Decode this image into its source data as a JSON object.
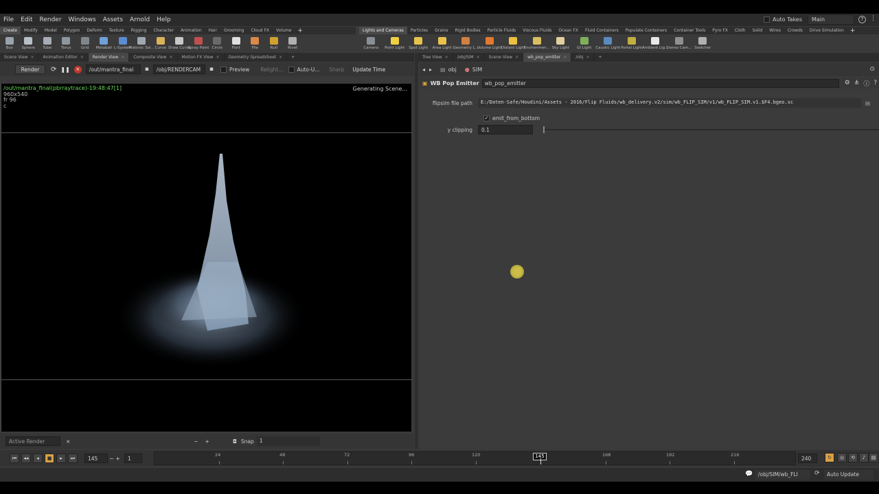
{
  "menubar": {
    "items": [
      "File",
      "Edit",
      "Render",
      "Windows",
      "Assets",
      "Arnold",
      "Help"
    ],
    "autotakes_label": "Auto Takes",
    "desktop": "Main"
  },
  "left_shelf": {
    "tabs": [
      "Create",
      "Modify",
      "Model",
      "Polygon",
      "Deform",
      "Texture",
      "Rigging",
      "Character",
      "Animation",
      "Hair",
      "Grooming",
      "Cloud FX",
      "Volume"
    ],
    "active_tab": 0,
    "tools": [
      {
        "label": "Box",
        "icon": "box-icon",
        "color": "#9aa3ad"
      },
      {
        "label": "Sphere",
        "icon": "sphere-icon",
        "color": "#b8bfc6"
      },
      {
        "label": "Tube",
        "icon": "tube-icon",
        "color": "#a6adb4"
      },
      {
        "label": "Torus",
        "icon": "torus-icon",
        "color": "#8f969c"
      },
      {
        "label": "Grid",
        "icon": "grid-icon",
        "color": "#7f868c"
      },
      {
        "label": "Metaball",
        "icon": "metaball-icon",
        "color": "#6fa0d8"
      },
      {
        "label": "L-System",
        "icon": "lsystem-icon",
        "color": "#5b8bd0"
      },
      {
        "label": "Platonic Sol...",
        "icon": "platonic-icon",
        "color": "#a1a8ae"
      },
      {
        "label": "Curve",
        "icon": "curve-icon",
        "color": "#d8b35a"
      },
      {
        "label": "Draw Curve",
        "icon": "draw-curve-icon",
        "color": "#c8c8c8"
      },
      {
        "label": "Spray Paint",
        "icon": "spray-paint-icon",
        "color": "#c0504d"
      },
      {
        "label": "Circle",
        "icon": "circle-icon",
        "color": "#6a6a6a"
      },
      {
        "label": "Font",
        "icon": "font-icon",
        "color": "#e0e0e0"
      },
      {
        "label": "File",
        "icon": "file-icon",
        "color": "#d9894a"
      },
      {
        "label": "Null",
        "icon": "null-icon",
        "color": "#d0a030"
      },
      {
        "label": "Rivet",
        "icon": "rivet-icon",
        "color": "#b0b0b0"
      }
    ]
  },
  "right_shelf": {
    "tabs": [
      "Lights and Cameras",
      "Particles",
      "Grains",
      "Rigid Bodies",
      "Particle Fluids",
      "Viscous Fluids",
      "Ocean FX",
      "Fluid Containers",
      "Populate Containers",
      "Container Tools",
      "Pyro FX",
      "Cloth",
      "Solid",
      "Wires",
      "Crowds",
      "Drive Simulation"
    ],
    "active_tab": 0,
    "tools": [
      {
        "label": "Camera",
        "icon": "camera-icon",
        "color": "#8a8f95"
      },
      {
        "label": "Point Light",
        "icon": "point-light-icon",
        "color": "#f0d040"
      },
      {
        "label": "Spot Light",
        "icon": "spot-light-icon",
        "color": "#e6c34a"
      },
      {
        "label": "Area Light",
        "icon": "area-light-icon",
        "color": "#e8c24c"
      },
      {
        "label": "Geometry L...",
        "icon": "geometry-light-icon",
        "color": "#d08040"
      },
      {
        "label": "Volume Light",
        "icon": "volume-light-icon",
        "color": "#e07a30"
      },
      {
        "label": "Distant Light",
        "icon": "distant-light-icon",
        "color": "#ecc040"
      },
      {
        "label": "Environmen...",
        "icon": "environment-light-icon",
        "color": "#d8c060"
      },
      {
        "label": "Sky Light",
        "icon": "sky-light-icon",
        "color": "#e0d0a0"
      },
      {
        "label": "GI Light",
        "icon": "gi-light-icon",
        "color": "#7fb05a"
      },
      {
        "label": "Caustic Light",
        "icon": "caustic-light-icon",
        "color": "#5a8ac0"
      },
      {
        "label": "Portal Light",
        "icon": "portal-light-icon",
        "color": "#c0b040"
      },
      {
        "label": "Ambient Lig...",
        "icon": "ambient-light-icon",
        "color": "#e8e8e8"
      },
      {
        "label": "Stereo Cam...",
        "icon": "stereo-camera-icon",
        "color": "#909090"
      },
      {
        "label": "Switcher",
        "icon": "switcher-icon",
        "color": "#b0b0b0"
      }
    ]
  },
  "left_pane_tabs": [
    "Scene View",
    "Animation Editor",
    "Render View",
    "Composite View",
    "Motion FX View",
    "Geometry Spreadsheet"
  ],
  "right_pane_tabs": [
    "Tree View",
    "/obj/SIM",
    "Scene View",
    "wb_pop_emitter",
    "/obj"
  ],
  "render_toolbar": {
    "render_label": "Render",
    "rop_path": "/out/mantra_final",
    "camera_path": "/obj/RENDERCAM",
    "preview_label": "Preview",
    "relight_label": "Relight...",
    "autoupdate_label": "Auto-U...",
    "sharp_label": "Sharp",
    "update_time_label": "Update Time"
  },
  "viewport": {
    "info_path": "/out/mantra_final(pbrraytrace)-19:48:47[1]",
    "resolution": "960x540",
    "frame_info": "fr 96",
    "extra": "c",
    "status": "Generating Scene..."
  },
  "viewport_bottom": {
    "active_render": "Active Render",
    "snap_label": "Snap",
    "snap_value": "1"
  },
  "path_bar": {
    "obj": "obj",
    "sim": "SIM"
  },
  "param_header": {
    "node_type": "WB Pop Emitter",
    "node_name": "wb_pop_emitter"
  },
  "params": {
    "flipsim_label": "flipsim file path",
    "flipsim_value": "E:/Daten-Safe/Houdini/Assets - 2016/Flip Fluids/wb_delivery.v2/sim/wb_FLIP_SIM/v1/wb_FLIP_SIM.v1.$F4.bgeo.sc",
    "emit_label": "emit_from_bottom",
    "emit_checked": true,
    "yclip_label": "y clipping",
    "yclip_value": "0.1"
  },
  "timeline": {
    "current_frame": "145",
    "start_frame": "1",
    "end_frame": "240",
    "ruler_labels": [
      "24",
      "48",
      "72",
      "96",
      "120",
      "145",
      "168",
      "192",
      "216"
    ]
  },
  "statusbar": {
    "path": "/obj/SIM/wb_FLI",
    "auto_update": "Auto Update"
  }
}
